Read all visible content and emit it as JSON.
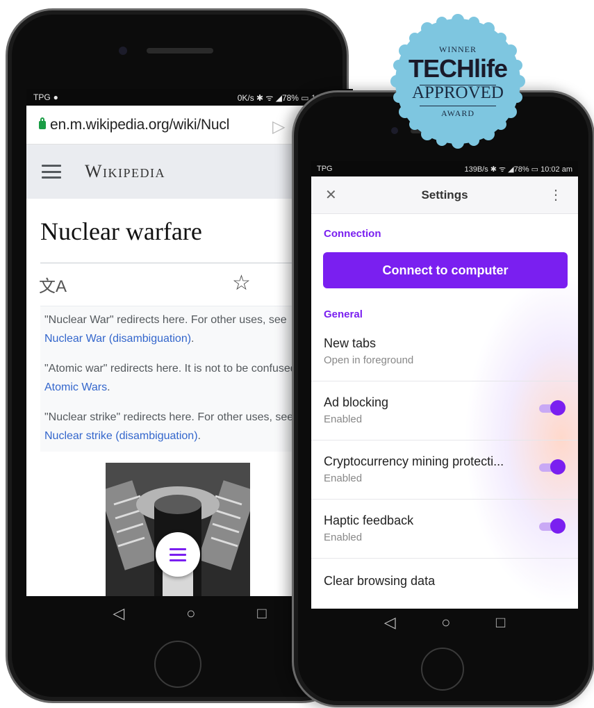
{
  "left_phone": {
    "status": {
      "carrier": "TPG",
      "right": "0K/s ✱ ᯤ ◢78% ▭ 10:02 am"
    },
    "url": "en.m.wikipedia.org/wiki/Nucl",
    "wiki_logo": "Wikipedia",
    "article_title": "Nuclear warfare",
    "hatnotes": [
      {
        "text": "\"Nuclear War\" redirects here. For other uses, see ",
        "link": "Nuclear War (disambiguation)",
        "tail": "."
      },
      {
        "text": "\"Atomic war\" redirects here. It is not to be confused with ",
        "link": "Atomic Wars",
        "tail": "."
      },
      {
        "text": "\"Nuclear strike\" redirects here. For other uses, see ",
        "link": "Nuclear strike (disambiguation)",
        "tail": "."
      }
    ],
    "icons": {
      "translate": "translate-icon",
      "star": "star-icon",
      "menu": "menu-icon",
      "send": "send-icon"
    }
  },
  "right_phone": {
    "status": {
      "carrier": "TPG",
      "right": "139B/s ✱ ᯤ ◢78% ▭ 10:02 am"
    },
    "header_title": "Settings",
    "sections": {
      "connection": "Connection",
      "general": "General"
    },
    "connect_button": "Connect to computer",
    "rows": [
      {
        "title": "New tabs",
        "subtitle": "Open in foreground",
        "toggle": false
      },
      {
        "title": "Ad blocking",
        "subtitle": "Enabled",
        "toggle": true
      },
      {
        "title": "Cryptocurrency mining protecti...",
        "subtitle": "Enabled",
        "toggle": true
      },
      {
        "title": "Haptic feedback",
        "subtitle": "Enabled",
        "toggle": true
      },
      {
        "title": "Clear browsing data",
        "subtitle": "",
        "toggle": false
      }
    ],
    "accent_color": "#7a1ff0"
  },
  "badge": {
    "winner": "WINNER",
    "brand": "TECHlife",
    "approved": "APPROVED",
    "award": "AWARD"
  }
}
